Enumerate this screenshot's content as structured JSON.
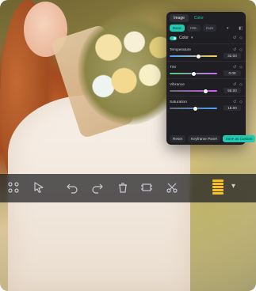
{
  "panel": {
    "tabs": [
      {
        "label": "Image"
      },
      {
        "label": "Color"
      }
    ],
    "subtabs": [
      {
        "label": "Basic"
      },
      {
        "label": "HSL"
      },
      {
        "label": "Curv"
      }
    ],
    "color_label": "Color",
    "rows": [
      {
        "title": "Temperature",
        "value": "32.00",
        "level": 0.62
      },
      {
        "title": "Tint",
        "value": "0.00",
        "level": 0.5
      },
      {
        "title": "Vibrance",
        "value": "55.00",
        "level": 0.78
      },
      {
        "title": "Saturation",
        "value": "18.00",
        "level": 0.55
      }
    ],
    "footer": {
      "reset": "Reset",
      "keyframe": "Keyframe Panel",
      "save": "Save as Custom"
    }
  },
  "toolbar": {
    "icons": [
      "grid-icon",
      "cursor-icon",
      "undo-icon",
      "redo-icon",
      "delete-icon",
      "crop-icon",
      "cut-icon",
      "audio-meter-icon",
      "chevron-down-icon"
    ]
  },
  "colors": {
    "accent": "#20c9b0",
    "panel": "#1f1f23",
    "meter": "#f7c11f"
  }
}
